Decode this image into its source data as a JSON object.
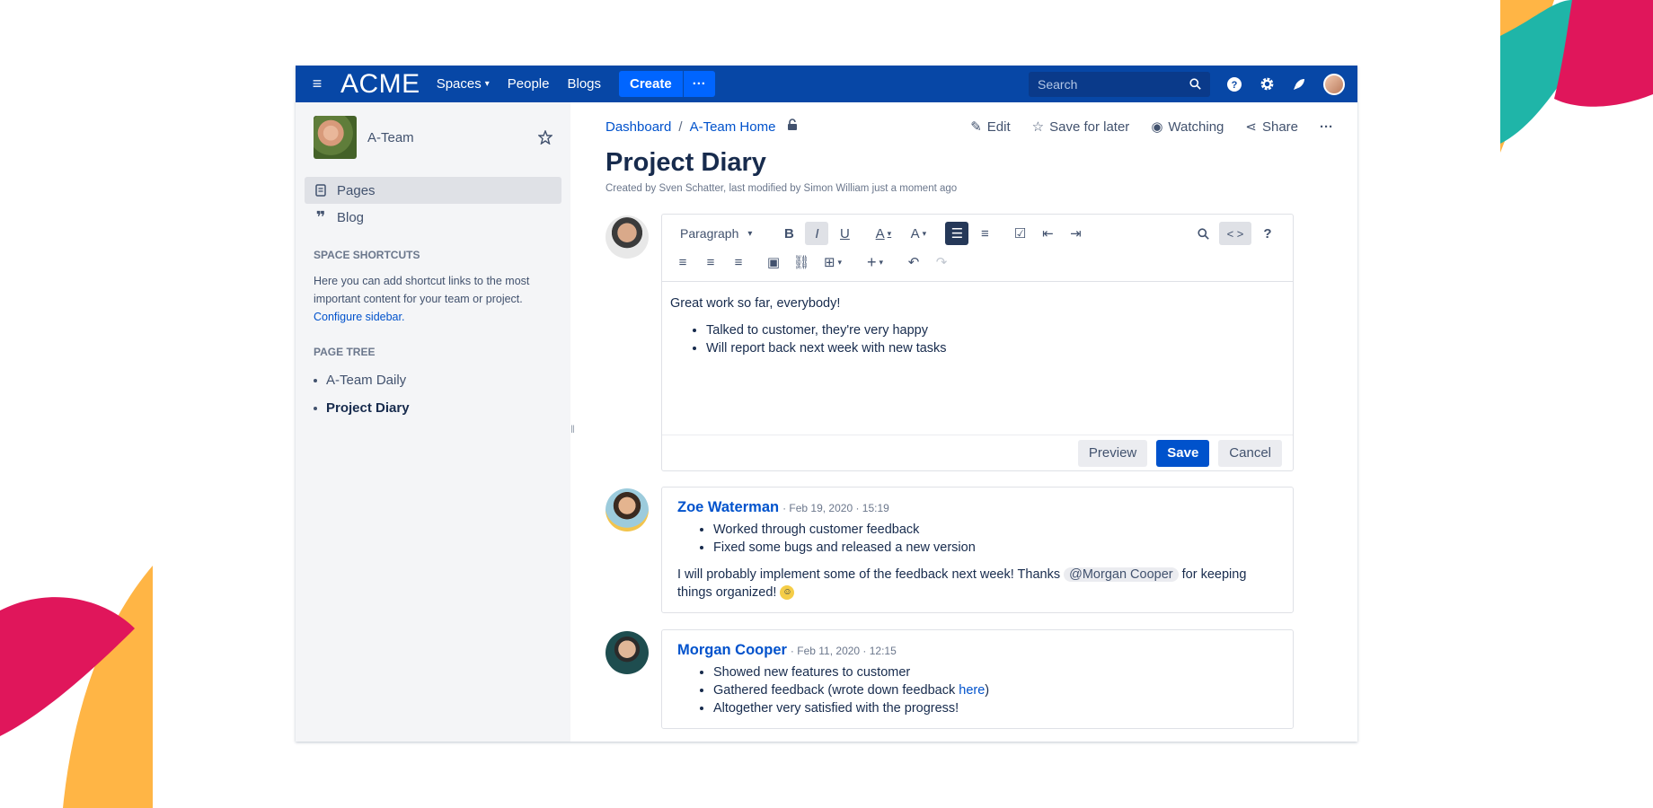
{
  "topnav": {
    "logo": "ACME",
    "links": [
      "Spaces",
      "People",
      "Blogs"
    ],
    "create": "Create",
    "more": "···",
    "search_placeholder": "Search"
  },
  "sidebar": {
    "space_name": "A-Team",
    "items": [
      {
        "label": "Pages"
      },
      {
        "label": "Blog"
      }
    ],
    "shortcuts_heading": "SPACE SHORTCUTS",
    "shortcuts_text": "Here you can add shortcut links to the most important content for your team or project.",
    "shortcuts_link": "Configure sidebar.",
    "tree_heading": "PAGE TREE",
    "tree": [
      "A-Team Daily",
      "Project Diary"
    ]
  },
  "breadcrumb": [
    "Dashboard",
    "A-Team Home"
  ],
  "actions": {
    "edit": "Edit",
    "save_later": "Save for later",
    "watching": "Watching",
    "share": "Share"
  },
  "page": {
    "title": "Project Diary",
    "byline": "Created by Sven Schatter, last modified by Simon William just a moment ago"
  },
  "editor": {
    "style_select": "Paragraph",
    "body_text": "Great work so far, everybody!",
    "bullets": [
      "Talked to customer, they're very happy",
      "Will report back next week with new tasks"
    ],
    "preview": "Preview",
    "save": "Save",
    "cancel": "Cancel"
  },
  "comments": [
    {
      "name": "Zoe Waterman",
      "meta": "· Feb 19, 2020 · 15:19",
      "bullets": [
        "Worked through customer feedback",
        "Fixed some bugs and released a new version"
      ],
      "text_before": "I will probably implement some of the feedback next week! Thanks ",
      "mention": "@Morgan Cooper",
      "text_after": " for keeping things organized! "
    },
    {
      "name": "Morgan Cooper",
      "meta": "· Feb 11, 2020 · 12:15",
      "bullet1": "Showed new features to customer",
      "bullet2_before": "Gathered feedback (wrote down feedback ",
      "bullet2_link": "here",
      "bullet2_after": ")",
      "bullet3": "Altogether very satisfied with the progress!"
    }
  ],
  "colors": {
    "nav": "#0747a6",
    "accent": "#0052cc",
    "create": "#0065ff"
  }
}
